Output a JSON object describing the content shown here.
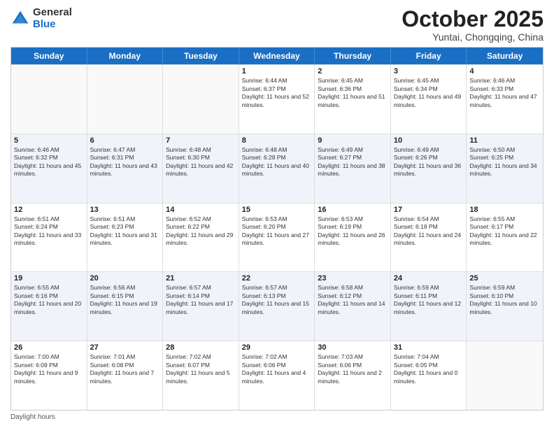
{
  "header": {
    "logo_general": "General",
    "logo_blue": "Blue",
    "month_title": "October 2025",
    "subtitle": "Yuntai, Chongqing, China"
  },
  "calendar": {
    "days_of_week": [
      "Sunday",
      "Monday",
      "Tuesday",
      "Wednesday",
      "Thursday",
      "Friday",
      "Saturday"
    ],
    "rows": [
      [
        {
          "day": "",
          "sunrise": "",
          "sunset": "",
          "daylight": ""
        },
        {
          "day": "",
          "sunrise": "",
          "sunset": "",
          "daylight": ""
        },
        {
          "day": "",
          "sunrise": "",
          "sunset": "",
          "daylight": ""
        },
        {
          "day": "1",
          "sunrise": "Sunrise: 6:44 AM",
          "sunset": "Sunset: 6:37 PM",
          "daylight": "Daylight: 11 hours and 52 minutes."
        },
        {
          "day": "2",
          "sunrise": "Sunrise: 6:45 AM",
          "sunset": "Sunset: 6:36 PM",
          "daylight": "Daylight: 11 hours and 51 minutes."
        },
        {
          "day": "3",
          "sunrise": "Sunrise: 6:45 AM",
          "sunset": "Sunset: 6:34 PM",
          "daylight": "Daylight: 11 hours and 49 minutes."
        },
        {
          "day": "4",
          "sunrise": "Sunrise: 6:46 AM",
          "sunset": "Sunset: 6:33 PM",
          "daylight": "Daylight: 11 hours and 47 minutes."
        }
      ],
      [
        {
          "day": "5",
          "sunrise": "Sunrise: 6:46 AM",
          "sunset": "Sunset: 6:32 PM",
          "daylight": "Daylight: 11 hours and 45 minutes."
        },
        {
          "day": "6",
          "sunrise": "Sunrise: 6:47 AM",
          "sunset": "Sunset: 6:31 PM",
          "daylight": "Daylight: 11 hours and 43 minutes."
        },
        {
          "day": "7",
          "sunrise": "Sunrise: 6:48 AM",
          "sunset": "Sunset: 6:30 PM",
          "daylight": "Daylight: 11 hours and 42 minutes."
        },
        {
          "day": "8",
          "sunrise": "Sunrise: 6:48 AM",
          "sunset": "Sunset: 6:28 PM",
          "daylight": "Daylight: 11 hours and 40 minutes."
        },
        {
          "day": "9",
          "sunrise": "Sunrise: 6:49 AM",
          "sunset": "Sunset: 6:27 PM",
          "daylight": "Daylight: 11 hours and 38 minutes."
        },
        {
          "day": "10",
          "sunrise": "Sunrise: 6:49 AM",
          "sunset": "Sunset: 6:26 PM",
          "daylight": "Daylight: 11 hours and 36 minutes."
        },
        {
          "day": "11",
          "sunrise": "Sunrise: 6:50 AM",
          "sunset": "Sunset: 6:25 PM",
          "daylight": "Daylight: 11 hours and 34 minutes."
        }
      ],
      [
        {
          "day": "12",
          "sunrise": "Sunrise: 6:51 AM",
          "sunset": "Sunset: 6:24 PM",
          "daylight": "Daylight: 11 hours and 33 minutes."
        },
        {
          "day": "13",
          "sunrise": "Sunrise: 6:51 AM",
          "sunset": "Sunset: 6:23 PM",
          "daylight": "Daylight: 11 hours and 31 minutes."
        },
        {
          "day": "14",
          "sunrise": "Sunrise: 6:52 AM",
          "sunset": "Sunset: 6:22 PM",
          "daylight": "Daylight: 11 hours and 29 minutes."
        },
        {
          "day": "15",
          "sunrise": "Sunrise: 6:53 AM",
          "sunset": "Sunset: 6:20 PM",
          "daylight": "Daylight: 11 hours and 27 minutes."
        },
        {
          "day": "16",
          "sunrise": "Sunrise: 6:53 AM",
          "sunset": "Sunset: 6:19 PM",
          "daylight": "Daylight: 11 hours and 26 minutes."
        },
        {
          "day": "17",
          "sunrise": "Sunrise: 6:54 AM",
          "sunset": "Sunset: 6:18 PM",
          "daylight": "Daylight: 11 hours and 24 minutes."
        },
        {
          "day": "18",
          "sunrise": "Sunrise: 6:55 AM",
          "sunset": "Sunset: 6:17 PM",
          "daylight": "Daylight: 11 hours and 22 minutes."
        }
      ],
      [
        {
          "day": "19",
          "sunrise": "Sunrise: 6:55 AM",
          "sunset": "Sunset: 6:16 PM",
          "daylight": "Daylight: 11 hours and 20 minutes."
        },
        {
          "day": "20",
          "sunrise": "Sunrise: 6:56 AM",
          "sunset": "Sunset: 6:15 PM",
          "daylight": "Daylight: 11 hours and 19 minutes."
        },
        {
          "day": "21",
          "sunrise": "Sunrise: 6:57 AM",
          "sunset": "Sunset: 6:14 PM",
          "daylight": "Daylight: 11 hours and 17 minutes."
        },
        {
          "day": "22",
          "sunrise": "Sunrise: 6:57 AM",
          "sunset": "Sunset: 6:13 PM",
          "daylight": "Daylight: 11 hours and 15 minutes."
        },
        {
          "day": "23",
          "sunrise": "Sunrise: 6:58 AM",
          "sunset": "Sunset: 6:12 PM",
          "daylight": "Daylight: 11 hours and 14 minutes."
        },
        {
          "day": "24",
          "sunrise": "Sunrise: 6:59 AM",
          "sunset": "Sunset: 6:11 PM",
          "daylight": "Daylight: 11 hours and 12 minutes."
        },
        {
          "day": "25",
          "sunrise": "Sunrise: 6:59 AM",
          "sunset": "Sunset: 6:10 PM",
          "daylight": "Daylight: 11 hours and 10 minutes."
        }
      ],
      [
        {
          "day": "26",
          "sunrise": "Sunrise: 7:00 AM",
          "sunset": "Sunset: 6:09 PM",
          "daylight": "Daylight: 11 hours and 9 minutes."
        },
        {
          "day": "27",
          "sunrise": "Sunrise: 7:01 AM",
          "sunset": "Sunset: 6:08 PM",
          "daylight": "Daylight: 11 hours and 7 minutes."
        },
        {
          "day": "28",
          "sunrise": "Sunrise: 7:02 AM",
          "sunset": "Sunset: 6:07 PM",
          "daylight": "Daylight: 11 hours and 5 minutes."
        },
        {
          "day": "29",
          "sunrise": "Sunrise: 7:02 AM",
          "sunset": "Sunset: 6:06 PM",
          "daylight": "Daylight: 11 hours and 4 minutes."
        },
        {
          "day": "30",
          "sunrise": "Sunrise: 7:03 AM",
          "sunset": "Sunset: 6:06 PM",
          "daylight": "Daylight: 11 hours and 2 minutes."
        },
        {
          "day": "31",
          "sunrise": "Sunrise: 7:04 AM",
          "sunset": "Sunset: 6:05 PM",
          "daylight": "Daylight: 11 hours and 0 minutes."
        },
        {
          "day": "",
          "sunrise": "",
          "sunset": "",
          "daylight": ""
        }
      ]
    ]
  },
  "footer": {
    "label": "Daylight hours"
  }
}
